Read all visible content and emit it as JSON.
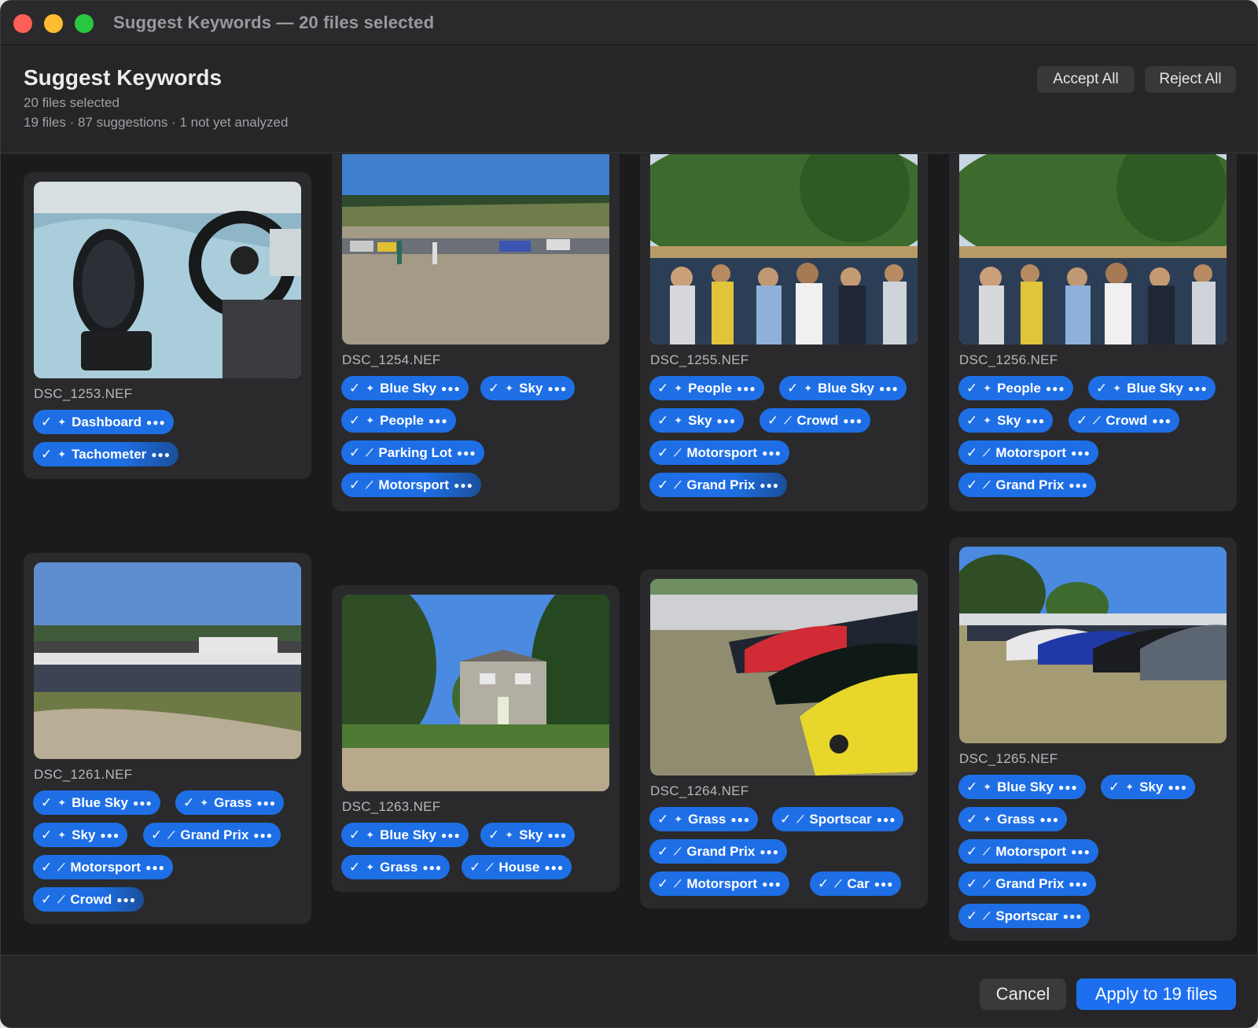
{
  "window": {
    "title": "Suggest Keywords — 20 files selected"
  },
  "header": {
    "title": "Suggest Keywords",
    "subtitle": "20 files selected",
    "summary": "19 files · 87 suggestions · 1 not yet analyzed",
    "accept_all": "Accept All",
    "reject_all": "Reject All"
  },
  "cards": [
    {
      "file": "DSC_1253.NEF",
      "keywords": [
        "Dashboard",
        "Tachometer"
      ]
    },
    {
      "file": "DSC_1254.NEF",
      "keywords": [
        "Blue Sky",
        "Sky",
        "People",
        "Parking Lot",
        "Motorsport"
      ]
    },
    {
      "file": "DSC_1255.NEF",
      "keywords": [
        "People",
        "Blue Sky",
        "Sky",
        "Crowd",
        "Motorsport",
        "Grand Prix"
      ]
    },
    {
      "file": "DSC_1256.NEF",
      "keywords": [
        "People",
        "Blue Sky",
        "Sky",
        "Crowd",
        "Motorsport",
        "Grand Prix"
      ]
    },
    {
      "file": "DSC_1261.NEF",
      "keywords": [
        "Blue Sky",
        "Grass",
        "Sky",
        "Grand Prix",
        "Motorsport",
        "Crowd"
      ]
    },
    {
      "file": "DSC_1263.NEF",
      "keywords": [
        "Blue Sky",
        "Sky",
        "Grass",
        "House"
      ]
    },
    {
      "file": "DSC_1264.NEF",
      "keywords": [
        "Grass",
        "Sportscar",
        "Grand Prix",
        "Motorsport",
        "Car"
      ]
    },
    {
      "file": "DSC_1265.NEF",
      "keywords": [
        "Blue Sky",
        "Sky",
        "Grass",
        "Motorsport",
        "Grand Prix",
        "Sportscar"
      ]
    }
  ],
  "footer": {
    "cancel": "Cancel",
    "apply": "Apply to 19 files"
  },
  "colors": {
    "accent": "#1e6fe6",
    "background": "#1b1b1d",
    "card": "#2a2a2c"
  }
}
